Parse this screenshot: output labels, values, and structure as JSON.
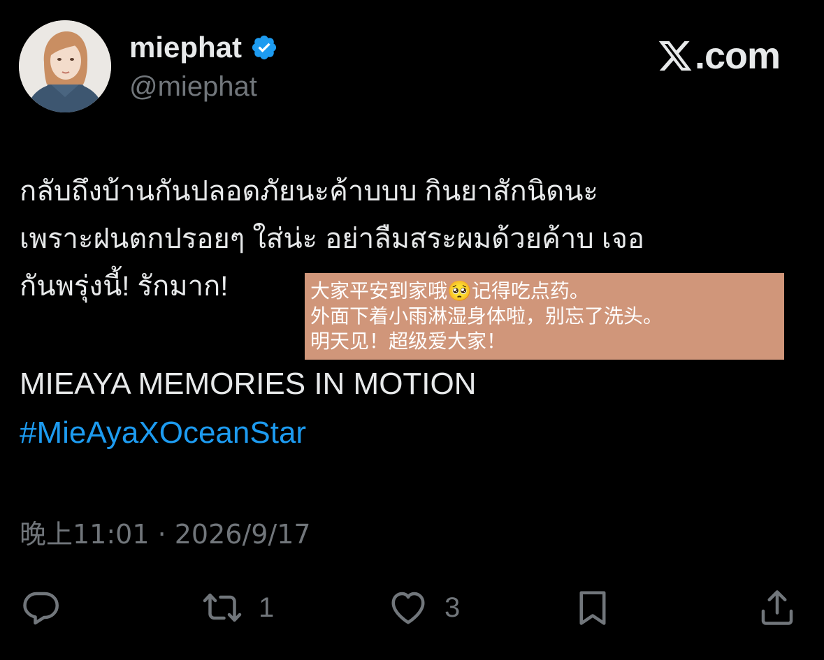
{
  "user": {
    "display_name": "miephat",
    "handle": "@miephat",
    "verified_icon": "verified-badge-icon",
    "avatar_icon": "avatar"
  },
  "brand": {
    "logo_icon": "x-logo-icon",
    "site_text": ".com"
  },
  "tweet": {
    "text": "กลับถึงบ้านกันปลอดภัยนะค้าบบบ กินยาสักนิดนะ\nเพราะฝนตกปรอยๆ ใส่น่ะ อย่าลืมสระผมด้วยค้าบ เจอ\nกันพรุ่งนี้! รักมาก!",
    "translation": "大家平安到家哦🥺记得吃点药。\n外面下着小雨淋湿身体啦，别忘了洗头。\n明天见！超级爱大家！",
    "title_line": "MIEAYA MEMORIES IN MOTION",
    "hashtag": "#MieAyaXOceanStar",
    "timestamp": "晚上11:01 · 2026/9/17"
  },
  "actions": {
    "reply_icon": "reply-icon",
    "retweet_icon": "retweet-icon",
    "retweet_count": "1",
    "like_icon": "heart-icon",
    "like_count": "3",
    "bookmark_icon": "bookmark-icon",
    "share_icon": "share-icon"
  },
  "colors": {
    "background": "#000000",
    "text": "#e7e9ea",
    "muted": "#71767b",
    "link": "#1d9bf0",
    "verified": "#1d9bf0",
    "overlay": "#d0967a"
  }
}
